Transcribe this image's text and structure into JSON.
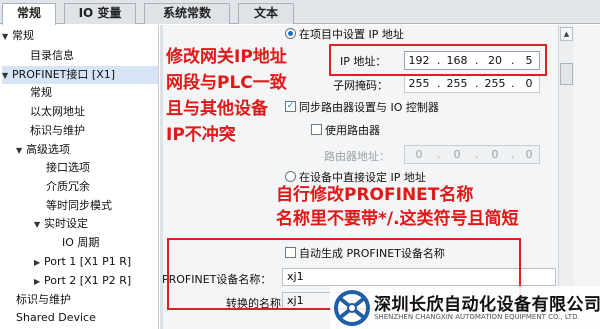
{
  "tabs": [
    {
      "label": "常规"
    },
    {
      "label": "IO 变量"
    },
    {
      "label": "系统常数"
    },
    {
      "label": "文本"
    }
  ],
  "tree": {
    "items": [
      {
        "label": "常规"
      },
      {
        "label": "目录信息"
      },
      {
        "label": "PROFINET接口 [X1]"
      },
      {
        "label": "常规"
      },
      {
        "label": "以太网地址"
      },
      {
        "label": "标识与维护"
      },
      {
        "label": "高级选项"
      },
      {
        "label": "接口选项"
      },
      {
        "label": "介质冗余"
      },
      {
        "label": "等时同步模式"
      },
      {
        "label": "实时设定"
      },
      {
        "label": "IO 周期"
      },
      {
        "label": "Port 1 [X1 P1 R]"
      },
      {
        "label": "Port 2 [X1 P2 R]"
      },
      {
        "label": "标识与维护"
      },
      {
        "label": "Shared Device"
      }
    ]
  },
  "ip": {
    "set_in_project_label": "在项目中设置 IP 地址",
    "ip_label": "IP 地址：",
    "ip_octets": [
      "192",
      "168",
      "20",
      "5"
    ],
    "mask_label": "子网掩码：",
    "mask_octets": [
      "255",
      "255",
      "255",
      "0"
    ],
    "sync_router_label": "同步路由器设置与 IO 控制器",
    "use_router_label": "使用路由器",
    "router_addr_label": "路由器地址：",
    "router_octets": [
      "0",
      "0",
      "0",
      "0"
    ],
    "set_on_device_label": "在设备中直接设定 IP 地址"
  },
  "profinet": {
    "auto_generate_label": "自动生成 PROFINET设备名称",
    "name_label": "PROFINET设备名称：",
    "name_value": "xj1",
    "converted_label": "转换的名称：",
    "converted_value": "xj1"
  },
  "annotations": {
    "ip_note": [
      "修改网关IP地址",
      "网段与PLC一致",
      "且与其他设备",
      "IP不冲突"
    ],
    "name_note": [
      "自行修改PROFINET名称",
      "名称里不要带*/.这类符号且简短"
    ]
  },
  "logo": {
    "cn": "深圳长欣自动化设备有限公司",
    "en": "SHENZHEN CHANGXIN AUTOMATION EQUIPMENT CO., LTD."
  },
  "colors": {
    "annotation_red": "#e01818",
    "radio_blue": "#1e6fc7",
    "logo_blue": "#1f5fa8"
  }
}
